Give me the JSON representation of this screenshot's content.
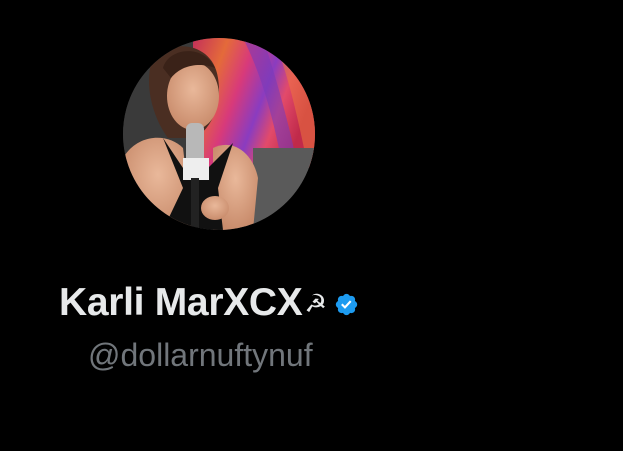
{
  "profile": {
    "display_name": "Karli MarXCX",
    "name_emoji": "☭",
    "handle": "@dollarnuftynuf",
    "verified": true
  },
  "colors": {
    "background": "#000000",
    "name_text": "#e7e9ea",
    "handle_text": "#71767b",
    "verified_badge": "#1d9bf0"
  },
  "icons": {
    "avatar": "profile-photo",
    "verified": "verified-badge-icon"
  }
}
